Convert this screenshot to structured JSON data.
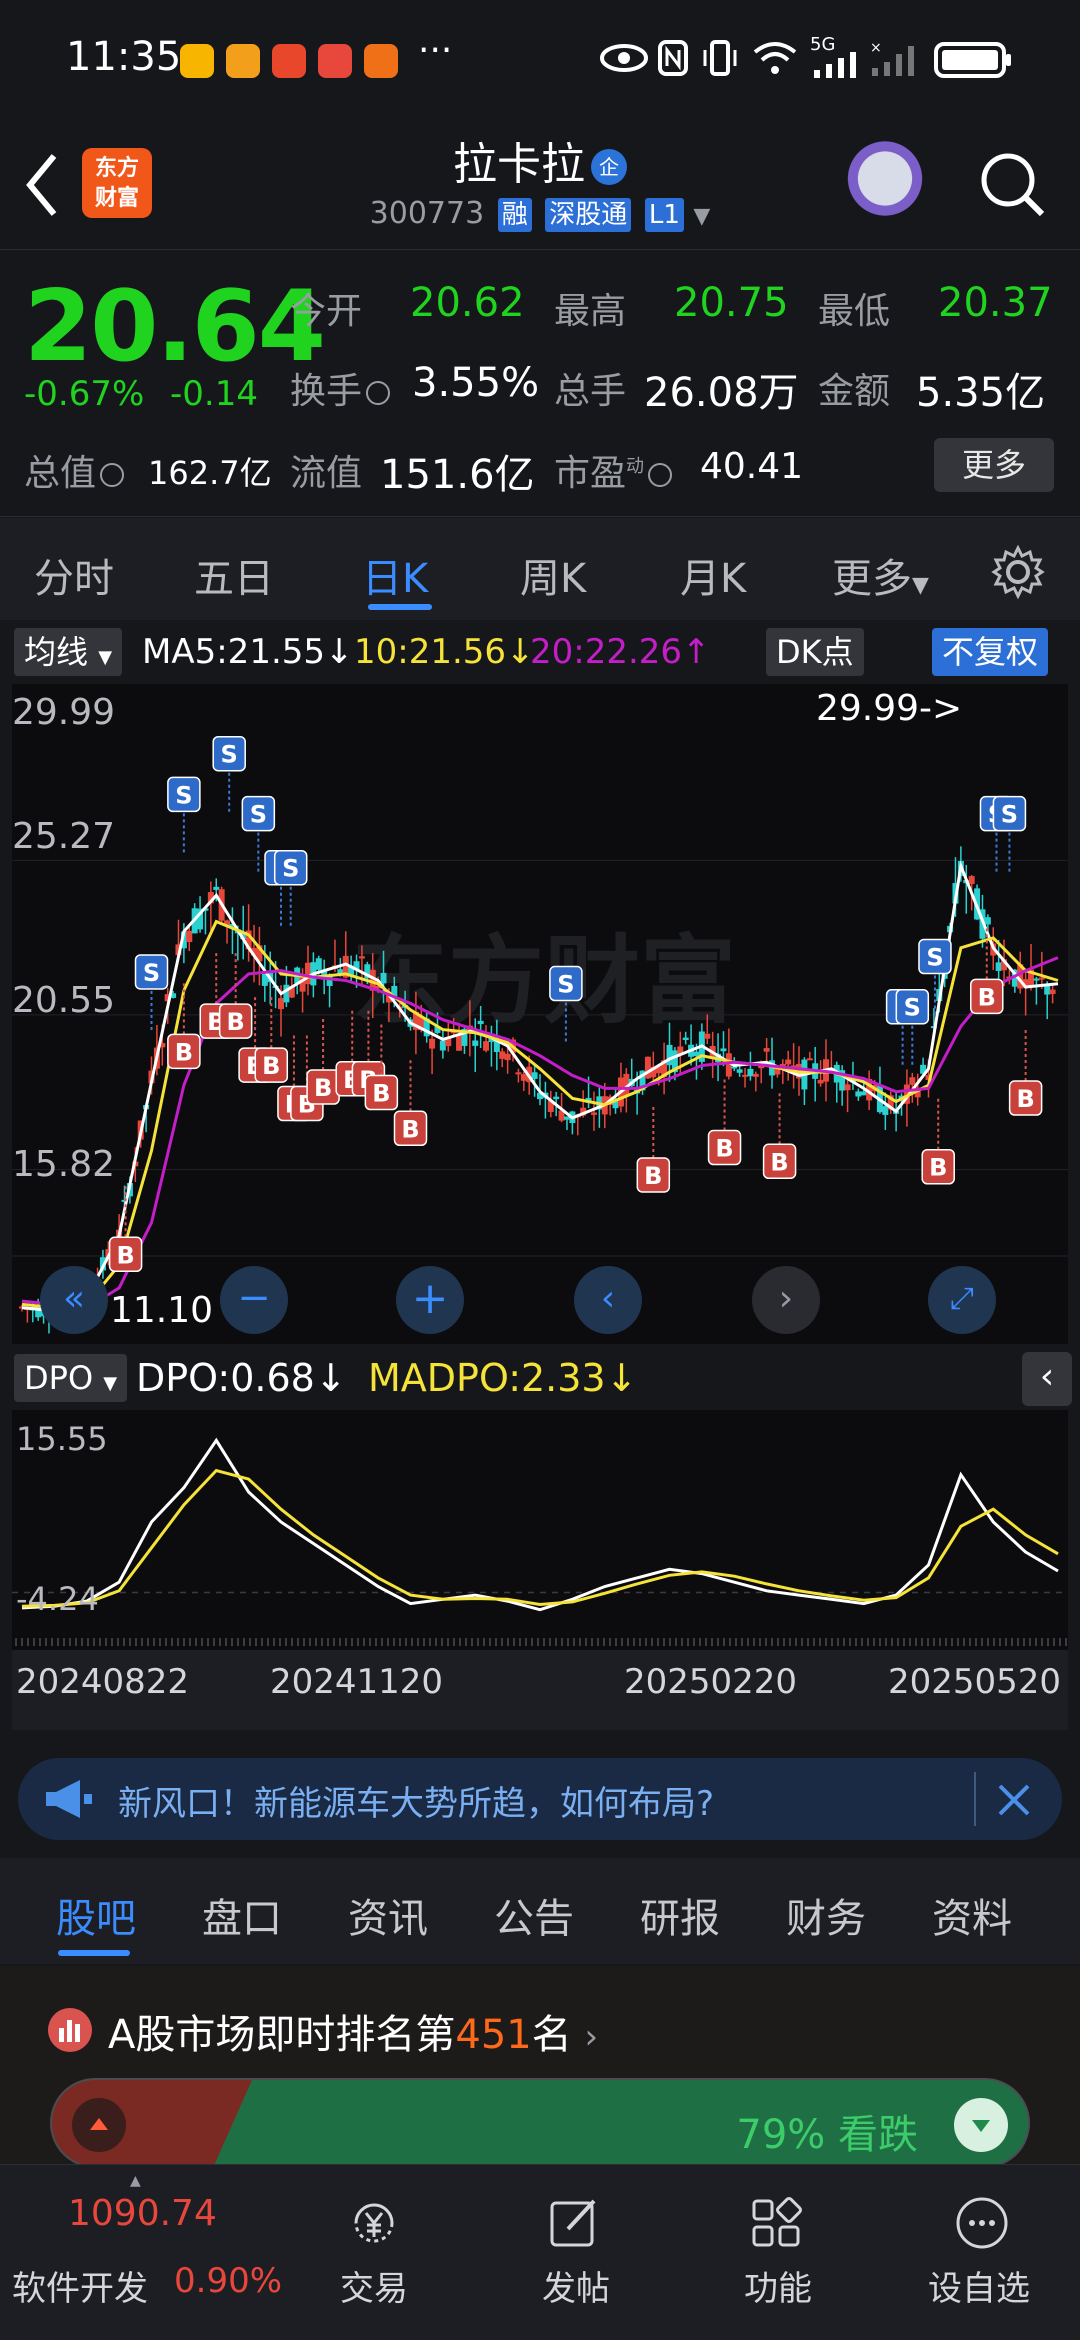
{
  "status_bar": {
    "time": "11:35",
    "more": "···",
    "network": "5G",
    "app_icon_colors": [
      "#f7b500",
      "#f2a01c",
      "#e8472b",
      "#e8473b",
      "#f07018"
    ]
  },
  "header": {
    "stock_name": "拉卡拉",
    "name_badge": "企",
    "code": "300773",
    "tags": [
      "融",
      "深股通",
      "L1"
    ],
    "logo_line1": "东方",
    "logo_line2": "财富"
  },
  "quote": {
    "price": "20.64",
    "change_pct": "-0.67%",
    "change": "-0.14",
    "open_label": "今开",
    "open": "20.62",
    "high_label": "最高",
    "high": "20.75",
    "low_label": "最低",
    "low": "20.37",
    "turnover_label": "换手",
    "turnover": "3.55%",
    "volume_label": "总手",
    "volume": "26.08万",
    "amount_label": "金额",
    "amount": "5.35亿",
    "mcap_label": "总值",
    "mcap": "162.7亿",
    "float_label": "流值",
    "float": "151.6亿",
    "pe_label": "市盈",
    "pe_sup": "动",
    "pe": "40.41",
    "more_label": "更多"
  },
  "period_tabs": [
    "分时",
    "五日",
    "日K",
    "周K",
    "月K",
    "更多"
  ],
  "active_period": "日K",
  "chart_head": {
    "indicator": "均线",
    "ma5": "MA5:21.55↓",
    "ma10": "10:21.56↓",
    "ma20": "20:22.26↑",
    "dk": "DK点",
    "adjust": "不复权"
  },
  "colors": {
    "up": "#e8473b",
    "down": "#2ad1d1",
    "ma5": "#ffffff",
    "ma10": "#f5e33a",
    "ma20": "#c41ec8",
    "accent": "#3b8cff"
  },
  "chart_data": [
    {
      "type": "candlestick",
      "title": "",
      "y_ticks": [
        "29.99",
        "25.27",
        "20.55",
        "15.82",
        "11.10"
      ],
      "ylim": [
        11.1,
        29.99
      ],
      "max_label": "29.99->",
      "min_label": "11.10",
      "x_dates": [
        "20240822",
        "20241120",
        "20250220",
        "20250520"
      ],
      "series": [
        {
          "name": "MA5",
          "values": [
            11.6,
            11.5,
            11.9,
            13.8,
            18.5,
            23.1,
            24.2,
            22.6,
            21.2,
            21.8,
            22.1,
            21.6,
            20.3,
            19.8,
            20.1,
            19.6,
            18.2,
            17.4,
            17.8,
            18.6,
            19.2,
            19.6,
            19.0,
            19.1,
            18.7,
            18.9,
            18.3,
            17.6,
            18.9,
            25.1,
            22.6,
            21.4,
            21.5
          ]
        },
        {
          "name": "MA10",
          "values": [
            11.7,
            11.6,
            11.7,
            12.9,
            16.4,
            21.3,
            23.4,
            23.0,
            21.8,
            21.7,
            21.8,
            21.5,
            20.7,
            20.1,
            20.0,
            19.7,
            18.9,
            18.0,
            17.8,
            18.2,
            18.8,
            19.3,
            19.1,
            19.0,
            18.8,
            18.8,
            18.5,
            17.9,
            18.4,
            22.6,
            22.9,
            21.9,
            21.6
          ]
        },
        {
          "name": "MA20",
          "values": [
            11.8,
            11.7,
            11.6,
            12.2,
            14.2,
            18.4,
            20.9,
            21.8,
            21.9,
            21.7,
            21.6,
            21.3,
            20.9,
            20.4,
            20.1,
            19.8,
            19.3,
            18.7,
            18.3,
            18.3,
            18.6,
            19.0,
            19.1,
            19.0,
            18.9,
            18.8,
            18.6,
            18.2,
            18.3,
            20.2,
            21.4,
            21.9,
            22.3
          ]
        }
      ],
      "signals_s": [
        "S",
        "S",
        "S",
        "S",
        "S",
        "S",
        "S",
        "S",
        "S",
        "S",
        "S",
        "S"
      ],
      "signals_b": [
        "B",
        "B",
        "B",
        "B",
        "B",
        "B",
        "B",
        "B",
        "B",
        "B",
        "B",
        "B",
        "B",
        "B",
        "B",
        "B",
        "B",
        "B",
        "B"
      ]
    },
    {
      "type": "line",
      "title": "",
      "y_ticks": [
        "15.55",
        "-4.24"
      ],
      "ylim": [
        -4.24,
        15.55
      ],
      "series": [
        {
          "name": "DPO",
          "values": [
            -4.0,
            -3.8,
            -3.2,
            -1.0,
            6.0,
            10.0,
            15.5,
            9.5,
            6.0,
            3.5,
            1.0,
            -1.5,
            -3.5,
            -3.0,
            -2.5,
            -3.2,
            -4.2,
            -3.0,
            -1.5,
            -0.5,
            0.5,
            0.0,
            -1.0,
            -2.0,
            -2.5,
            -3.0,
            -3.5,
            -2.5,
            1.0,
            11.5,
            6.0,
            2.5,
            0.3
          ]
        },
        {
          "name": "MADPO",
          "values": [
            -3.8,
            -3.7,
            -3.4,
            -2.0,
            3.0,
            8.0,
            12.0,
            11.0,
            7.5,
            4.5,
            2.0,
            -0.5,
            -2.5,
            -3.0,
            -2.9,
            -3.0,
            -3.6,
            -3.3,
            -2.3,
            -1.2,
            -0.2,
            0.2,
            -0.3,
            -1.2,
            -2.0,
            -2.6,
            -3.1,
            -2.8,
            -0.5,
            5.5,
            7.5,
            4.5,
            2.3
          ]
        }
      ]
    }
  ],
  "dpo_head": {
    "indicator": "DPO",
    "dpo": "DPO:0.68↓",
    "madpo": "MADPO:2.33↓"
  },
  "watermark": "东方财富",
  "banner": {
    "text": "新风口！新能源车大势所趋，如何布局?"
  },
  "content_tabs": [
    "股吧",
    "盘口",
    "资讯",
    "公告",
    "研报",
    "财务",
    "资料"
  ],
  "active_content_tab": "股吧",
  "ranking": {
    "prefix": "A股市场即时排名第",
    "number": "451",
    "suffix": "名",
    "sentiment": "79% 看跌"
  },
  "bottom_nav": {
    "index_value": "1090.74",
    "index_name": "软件开发",
    "index_pct": "0.90%",
    "items": [
      "交易",
      "发帖",
      "功能",
      "设自选"
    ]
  }
}
